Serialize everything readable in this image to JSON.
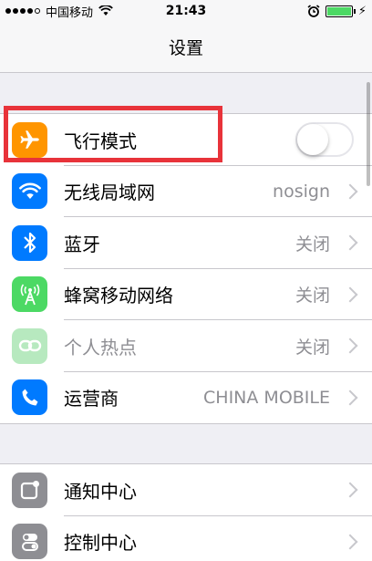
{
  "status_bar": {
    "carrier": "中国移动",
    "time": "21:43"
  },
  "nav": {
    "title": "设置"
  },
  "group1": [
    {
      "label": "飞行模式",
      "icon": "airplane-icon",
      "color": "#ff9500",
      "type": "toggle",
      "toggle_on": false
    },
    {
      "label": "无线局域网",
      "icon": "wifi-icon",
      "color": "#007aff",
      "value": "nosign"
    },
    {
      "label": "蓝牙",
      "icon": "bluetooth-icon",
      "color": "#007aff",
      "value": "关闭"
    },
    {
      "label": "蜂窝移动网络",
      "icon": "cellular-icon",
      "color": "#4cd964",
      "value": "关闭"
    },
    {
      "label": "个人热点",
      "icon": "hotspot-icon",
      "color": "#b7e9bf",
      "value": "关闭"
    },
    {
      "label": "运营商",
      "icon": "phone-icon",
      "color": "#007aff",
      "value": "CHINA MOBILE"
    }
  ],
  "group2": [
    {
      "label": "通知中心",
      "icon": "notification-icon",
      "color": "#8e8e93"
    },
    {
      "label": "控制中心",
      "icon": "control-center-icon",
      "color": "#8e8e93"
    }
  ],
  "colors": {
    "accent_highlight": "#e8333a"
  }
}
